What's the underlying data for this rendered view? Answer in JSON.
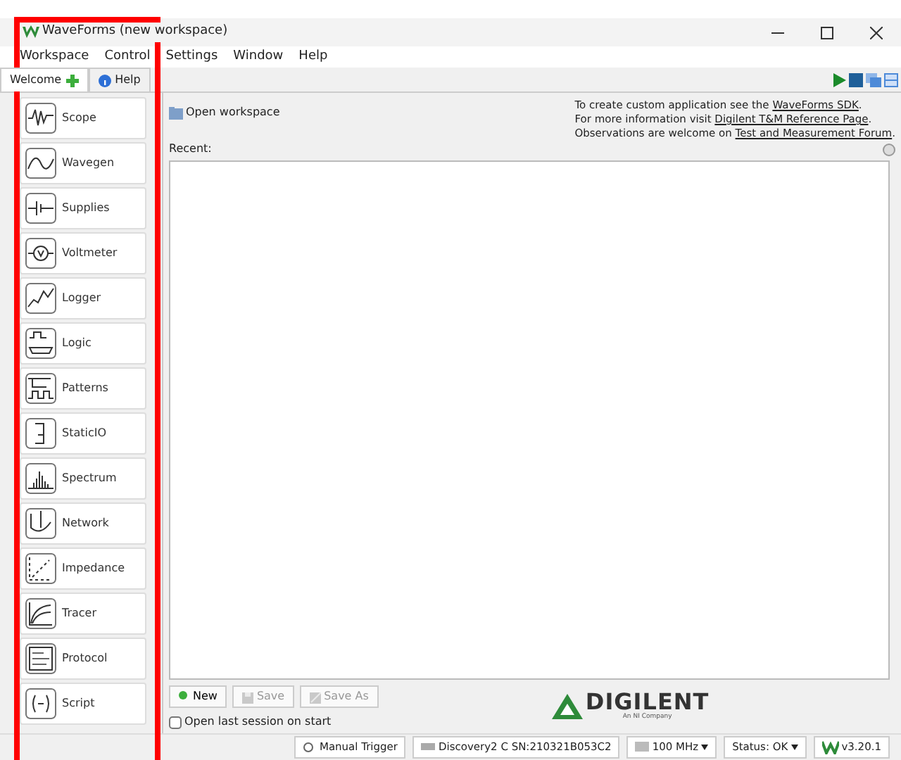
{
  "window": {
    "title": "WaveForms (new workspace)"
  },
  "menu": [
    "Workspace",
    "Control",
    "Settings",
    "Window",
    "Help"
  ],
  "tabs": [
    {
      "label": "Welcome",
      "selected": true
    },
    {
      "label": "Help",
      "selected": false
    }
  ],
  "sidebar": {
    "items": [
      {
        "label": "Scope"
      },
      {
        "label": "Wavegen"
      },
      {
        "label": "Supplies"
      },
      {
        "label": "Voltmeter"
      },
      {
        "label": "Logger"
      },
      {
        "label": "Logic"
      },
      {
        "label": "Patterns"
      },
      {
        "label": "StaticIO"
      },
      {
        "label": "Spectrum"
      },
      {
        "label": "Network"
      },
      {
        "label": "Impedance"
      },
      {
        "label": "Tracer"
      },
      {
        "label": "Protocol"
      },
      {
        "label": "Script"
      }
    ]
  },
  "welcome": {
    "open_workspace": "Open workspace",
    "info": [
      {
        "text": "To create custom application see the ",
        "link": "WaveForms SDK",
        "end": "."
      },
      {
        "text": "For more information visit ",
        "link": "Digilent T&M Reference Page",
        "end": "."
      },
      {
        "text": "Observations are welcome on ",
        "link": "Test and Measurement Forum",
        "end": "."
      }
    ],
    "recent_label": "Recent:",
    "buttons": [
      {
        "label": "New",
        "disabled": false
      },
      {
        "label": "Save",
        "disabled": true
      },
      {
        "label": "Save As",
        "disabled": true
      }
    ],
    "logo": {
      "name": "DIGILENT",
      "tagline": "An NI Company"
    },
    "open_last_session": {
      "label": "Open last session on start",
      "checked": false
    }
  },
  "status_bar": [
    {
      "label": "Manual Trigger",
      "dropdown": false
    },
    {
      "label": "Discovery2 C SN:210321B053C2",
      "dropdown": false
    },
    {
      "label": "100 MHz",
      "dropdown": true
    },
    {
      "label": "Status: OK",
      "dropdown": true
    },
    {
      "label": "v3.20.1",
      "dropdown": false
    }
  ],
  "highlight": {
    "shown": true,
    "color": "#ff0000"
  }
}
